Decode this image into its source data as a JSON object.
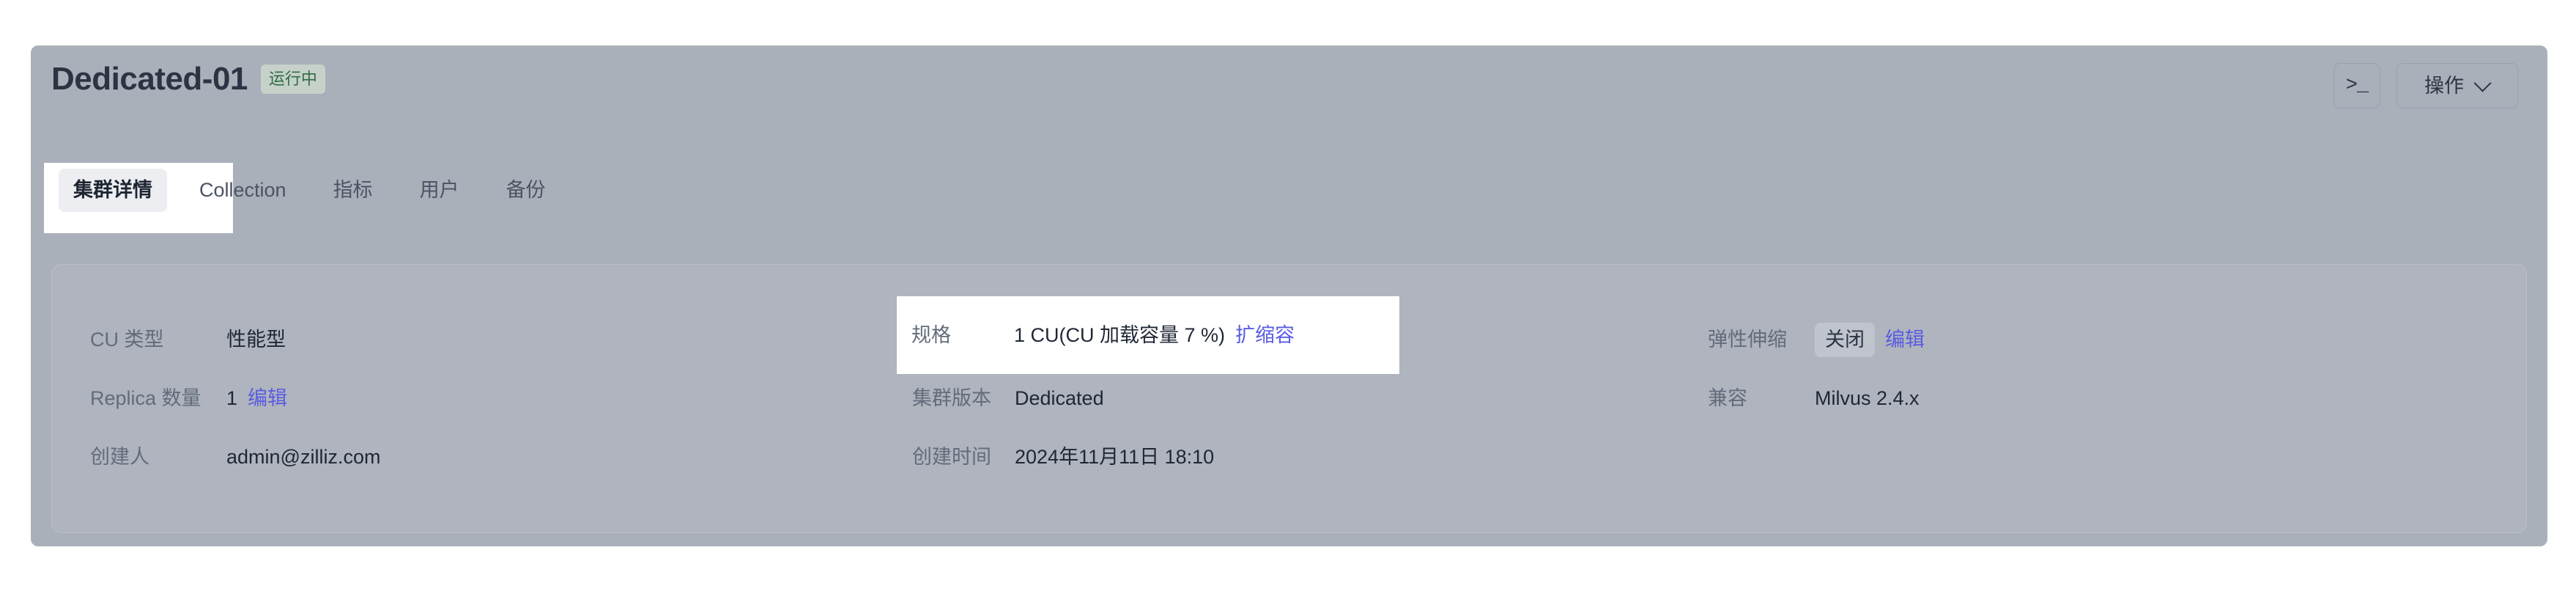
{
  "header": {
    "title": "Dedicated-01",
    "status_badge": "运行中",
    "terminal_icon": "terminal-icon",
    "terminal_glyph": ">_",
    "action_label": "操作",
    "chevron_icon": "chevron-down-icon"
  },
  "tabs": [
    {
      "label": "集群详情",
      "active": true
    },
    {
      "label": "Collection",
      "active": false
    },
    {
      "label": "指标",
      "active": false
    },
    {
      "label": "用户",
      "active": false
    },
    {
      "label": "备份",
      "active": false
    }
  ],
  "details": {
    "col1": [
      {
        "label": "CU 类型",
        "value": "性能型",
        "link": ""
      },
      {
        "label": "Replica 数量",
        "value": "1",
        "link": "编辑"
      },
      {
        "label": "创建人",
        "value": "admin@zilliz.com",
        "link": ""
      }
    ],
    "col2": [
      {
        "label": "规格",
        "value": "1 CU(CU 加载容量 7 %)",
        "link": "扩缩容"
      },
      {
        "label": "集群版本",
        "value": "Dedicated",
        "link": ""
      },
      {
        "label": "创建时间",
        "value": "2024年11月11日 18:10",
        "link": ""
      }
    ],
    "col3": [
      {
        "label": "弹性伸缩",
        "chip": "关闭",
        "link": "编辑"
      },
      {
        "label": "兼容",
        "value": "Milvus 2.4.x",
        "link": ""
      }
    ]
  },
  "colors": {
    "card_overlay": "#aab0ba",
    "status_badge_bg": "#c6d2c9",
    "status_badge_text": "#2f6b46",
    "link": "#5a5ce0",
    "title_text": "#2c3444",
    "label_text": "#636c7c",
    "highlight": "#ffffff"
  }
}
